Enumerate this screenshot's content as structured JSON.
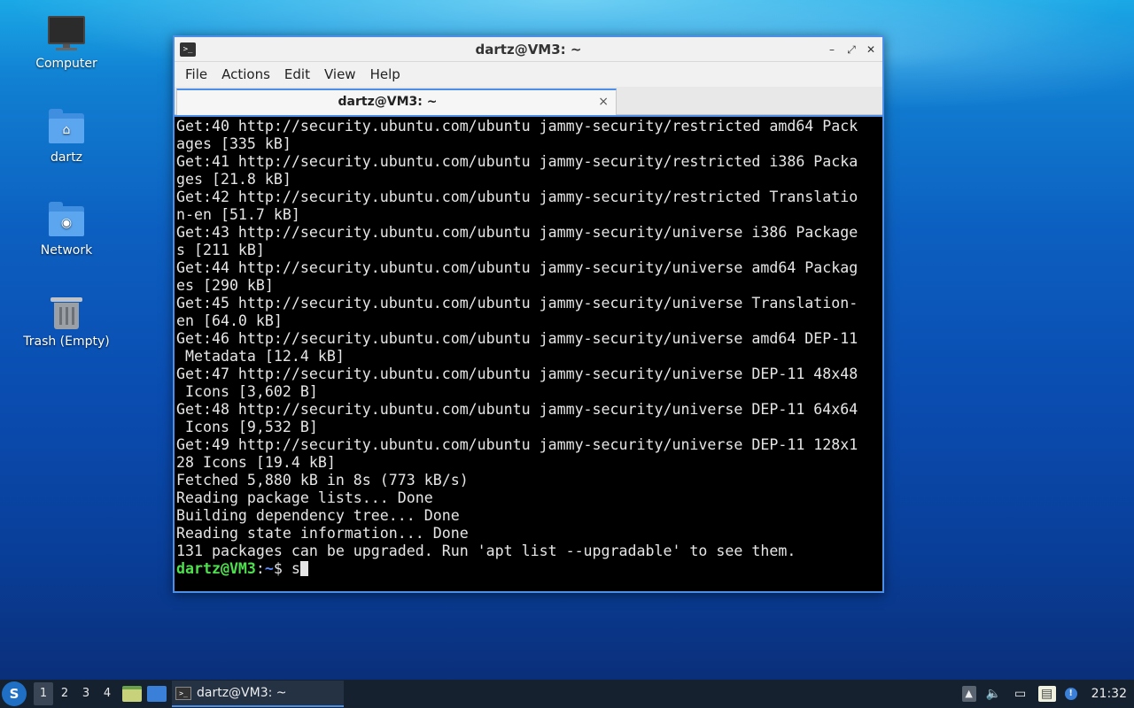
{
  "desktop": {
    "icons": [
      {
        "label": "Computer",
        "icon": "computer-icon"
      },
      {
        "label": "dartz",
        "icon": "home-folder-icon",
        "glyph": "⌂"
      },
      {
        "label": "Network",
        "icon": "network-folder-icon",
        "glyph": "◉"
      },
      {
        "label": "Trash (Empty)",
        "icon": "trash-icon"
      }
    ]
  },
  "window": {
    "title": "dartz@VM3: ~",
    "controls": {
      "minimize": "–",
      "maximize": "⤢",
      "close": "✕"
    },
    "menu": [
      "File",
      "Actions",
      "Edit",
      "View",
      "Help"
    ],
    "tab": {
      "title": "dartz@VM3: ~",
      "close": "×"
    },
    "terminal": {
      "lines": [
        "Get:40 http://security.ubuntu.com/ubuntu jammy-security/restricted amd64 Pack",
        "ages [335 kB]",
        "Get:41 http://security.ubuntu.com/ubuntu jammy-security/restricted i386 Packa",
        "ges [21.8 kB]",
        "Get:42 http://security.ubuntu.com/ubuntu jammy-security/restricted Translatio",
        "n-en [51.7 kB]",
        "Get:43 http://security.ubuntu.com/ubuntu jammy-security/universe i386 Package",
        "s [211 kB]",
        "Get:44 http://security.ubuntu.com/ubuntu jammy-security/universe amd64 Packag",
        "es [290 kB]",
        "Get:45 http://security.ubuntu.com/ubuntu jammy-security/universe Translation-",
        "en [64.0 kB]",
        "Get:46 http://security.ubuntu.com/ubuntu jammy-security/universe amd64 DEP-11",
        " Metadata [12.4 kB]",
        "Get:47 http://security.ubuntu.com/ubuntu jammy-security/universe DEP-11 48x48",
        " Icons [3,602 B]",
        "Get:48 http://security.ubuntu.com/ubuntu jammy-security/universe DEP-11 64x64",
        " Icons [9,532 B]",
        "Get:49 http://security.ubuntu.com/ubuntu jammy-security/universe DEP-11 128x1",
        "28 Icons [19.4 kB]",
        "Fetched 5,880 kB in 8s (773 kB/s)",
        "Reading package lists... Done",
        "Building dependency tree... Done",
        "Reading state information... Done",
        "131 packages can be upgraded. Run 'apt list --upgradable' to see them."
      ],
      "prompt_user": "dartz@VM3",
      "prompt_sep": ":",
      "prompt_path": "~",
      "prompt_symbol": "$ ",
      "input": "s"
    }
  },
  "taskbar": {
    "start_glyph": "S",
    "workspaces": [
      "1",
      "2",
      "3",
      "4"
    ],
    "active_workspace": "1",
    "task": {
      "label": "dartz@VM3: ~",
      "icon_glyph": ">_"
    },
    "tray": {
      "up_arrow": "▲",
      "volume": "🔈",
      "network": "▭",
      "clipboard": "▤",
      "updates": "!"
    },
    "clock": "21:32"
  },
  "colors": {
    "accent": "#4c8fe8",
    "prompt_user": "#4ee04e",
    "prompt_path": "#5a8cff",
    "taskbar": "#16212f"
  }
}
